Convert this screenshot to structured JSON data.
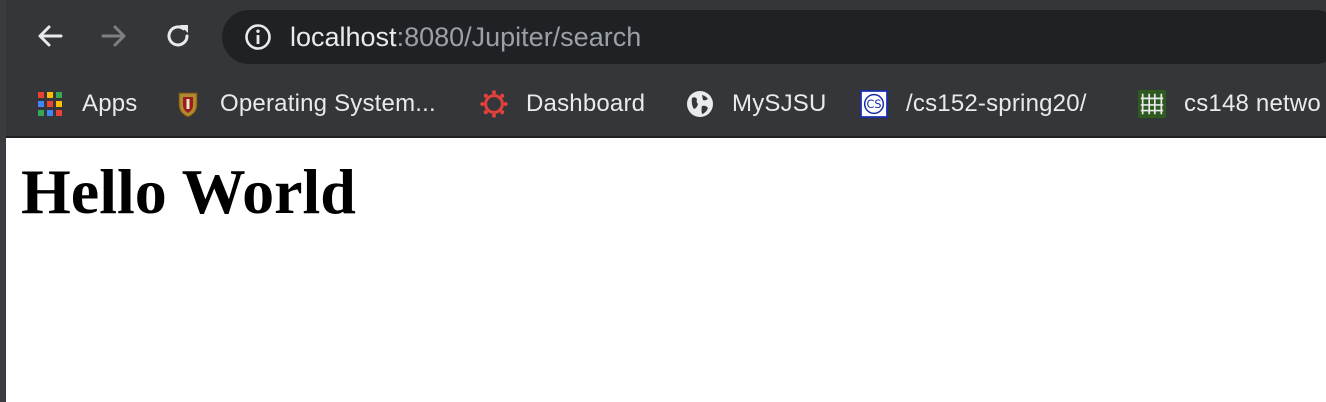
{
  "toolbar": {
    "url_host": "localhost",
    "url_rest": ":8080/Jupiter/search",
    "icons": [
      "back-arrow-icon",
      "forward-arrow-icon",
      "reload-icon",
      "info-icon"
    ]
  },
  "bookmarks": [
    {
      "label": "Apps",
      "icon": "apps-grid-icon"
    },
    {
      "label": "Operating System...",
      "icon": "crest-icon"
    },
    {
      "label": "Dashboard",
      "icon": "canvas-logo-icon"
    },
    {
      "label": "MySJSU",
      "icon": "globe-icon"
    },
    {
      "label": "/cs152-spring20/",
      "icon": "cs-logo-icon"
    },
    {
      "label": "cs148 netwo",
      "icon": "network-icon"
    }
  ],
  "page": {
    "heading": "Hello World"
  },
  "colors": {
    "toolbar_bg": "#35363a",
    "omnibox_bg": "#202124",
    "text_light": "#e8eaed",
    "text_muted": "#9aa0a6",
    "dashboard_red": "#e0413b"
  }
}
